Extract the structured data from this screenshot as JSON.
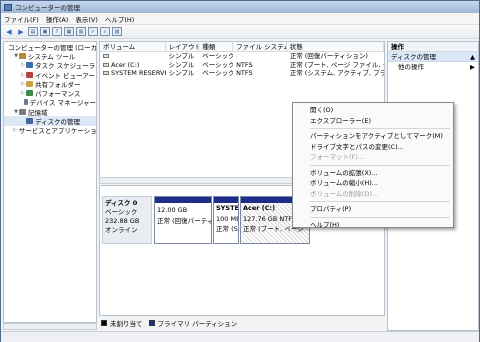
{
  "window": {
    "title": "コンピューターの管理"
  },
  "menubar": {
    "items": [
      "ファイル(F)",
      "操作(A)",
      "表示(V)",
      "ヘルプ(H)"
    ]
  },
  "toolbar": {
    "icons": [
      "back-icon",
      "forward-icon",
      "up-icon",
      "console-icon",
      "properties-icon",
      "help-icon",
      "disk-icon",
      "check-icon",
      "search-icon",
      "refresh-icon"
    ]
  },
  "tree": {
    "items": [
      {
        "label": "コンピューターの管理 (ローカ",
        "exp": "",
        "level": 0,
        "color": "#6b6b6b"
      },
      {
        "label": "システム ツール",
        "exp": "▼",
        "level": 1,
        "color": "#b5893a"
      },
      {
        "label": "タスク スケジューラ",
        "exp": "▷",
        "level": 2,
        "color": "#3a6fa8"
      },
      {
        "label": "イベント ビューアー",
        "exp": "▷",
        "level": 2,
        "color": "#b54040"
      },
      {
        "label": "共有フォルダー",
        "exp": "▷",
        "level": 2,
        "color": "#c9a247"
      },
      {
        "label": "パフォーマンス",
        "exp": "▷",
        "level": 2,
        "color": "#3a8a4a"
      },
      {
        "label": "デバイス マネージャー",
        "exp": "",
        "level": 2,
        "color": "#6d7c93"
      },
      {
        "label": "記憶域",
        "exp": "▼",
        "level": 1,
        "color": "#7a7a7a"
      },
      {
        "label": "ディスクの管理",
        "exp": "",
        "level": 2,
        "color": "#44649a",
        "selected": true
      },
      {
        "label": "サービスとアプリケーショ",
        "exp": "▷",
        "level": 1,
        "color": "#5a7a9a"
      }
    ]
  },
  "volume_list": {
    "columns": [
      "ボリューム",
      "レイアウト",
      "種類",
      "ファイル システム",
      "状態"
    ],
    "rows": [
      [
        "",
        "シンプル",
        "ベーシック",
        "",
        "正常 (回復パーティション)"
      ],
      [
        "Acer (C:)",
        "シンプル",
        "ベーシック",
        "NTFS",
        "正常 (ブート, ページ ファイル, クラ"
      ],
      [
        "SYSTEM RESERVED",
        "シンプル",
        "ベーシック",
        "NTFS",
        "正常 (システム, アクティブ, プライ"
      ]
    ]
  },
  "disk": {
    "name": "ディスク 0",
    "type": "ベーシック",
    "size": "232.88 GB",
    "status": "オンライン",
    "partitions": [
      {
        "name": "",
        "size": "12.00 GB",
        "status": "正常 (回復パーティ"
      },
      {
        "name": "SYSTEI",
        "size": "100 MB",
        "status": "正常 (S"
      },
      {
        "name": "Acer (C:)",
        "size": "127.76 GB NTFS",
        "status": "正常 (ブート, ページ"
      }
    ]
  },
  "legend": {
    "unallocated": "未割り当て",
    "primary": "プライマリ パーティション",
    "unallocated_color": "#000000",
    "primary_color": "#1c2e8a"
  },
  "actions": {
    "header": "操作",
    "selected": "ディスクの管理",
    "more": "他の操作"
  },
  "context_menu": {
    "groups": [
      [
        {
          "label": "開く(O)",
          "disabled": false
        },
        {
          "label": "エクスプローラー(E)",
          "disabled": false
        }
      ],
      [
        {
          "label": "パーティションをアクティブとしてマーク(M)",
          "disabled": false
        },
        {
          "label": "ドライブ文字とパスの変更(C)...",
          "disabled": false
        },
        {
          "label": "フォーマット(F)...",
          "disabled": true
        }
      ],
      [
        {
          "label": "ボリュームの拡張(X)...",
          "disabled": false
        },
        {
          "label": "ボリュームの縮小(H)...",
          "disabled": false
        },
        {
          "label": "ボリュームの削除(D)...",
          "disabled": true
        }
      ],
      [
        {
          "label": "プロパティ(P)",
          "disabled": false
        }
      ],
      [
        {
          "label": "ヘルプ(H)",
          "disabled": false
        }
      ]
    ]
  }
}
